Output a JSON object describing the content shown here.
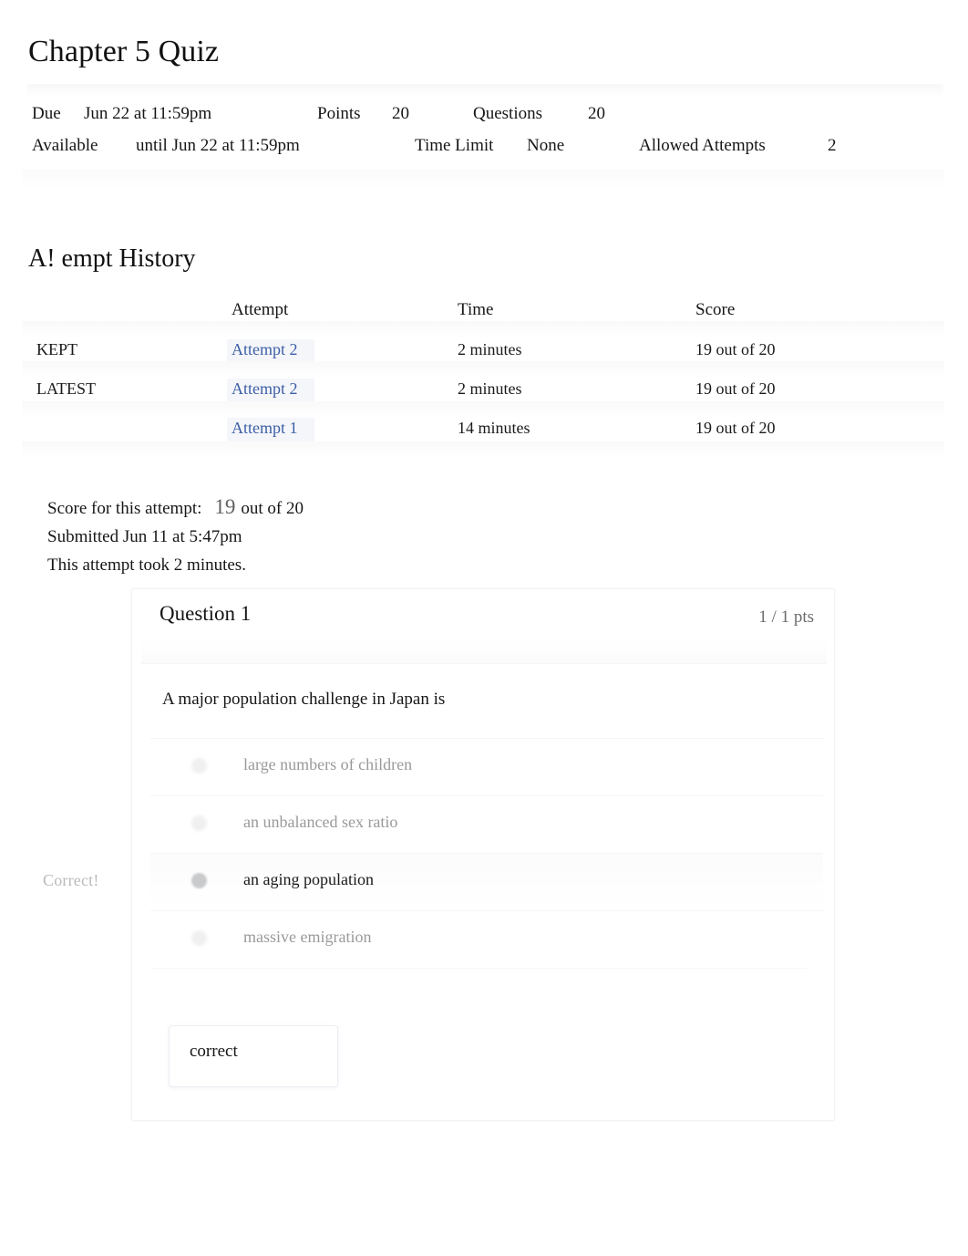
{
  "quiz": {
    "title": "Chapter 5 Quiz",
    "meta": {
      "due_label": "Due",
      "due_value": "Jun 22 at 11:59pm",
      "points_label": "Points",
      "points_value": "20",
      "questions_label": "Questions",
      "questions_value": "20",
      "available_label": "Available",
      "available_value": "until Jun 22 at 11:59pm",
      "time_limit_label": "Time Limit",
      "time_limit_value": "None",
      "allowed_attempts_label": "Allowed Attempts",
      "allowed_attempts_value": "2"
    }
  },
  "attempt_history": {
    "heading": "A! empt History",
    "columns": [
      "",
      "Attempt",
      "Time",
      "Score"
    ],
    "rows": [
      {
        "label": "KEPT",
        "attempt": "Attempt 2",
        "time": "2 minutes",
        "score": "19 out of 20"
      },
      {
        "label": "LATEST",
        "attempt": "Attempt 2",
        "time": "2 minutes",
        "score": "19 out of 20"
      },
      {
        "label": "",
        "attempt": "Attempt 1",
        "time": "14 minutes",
        "score": "19 out of 20"
      }
    ]
  },
  "score_summary": {
    "score_label": "Score for this attempt:",
    "score_value": "19",
    "score_suffix": "out of 20",
    "submitted": "Submitted Jun 11 at 5:47pm",
    "duration": "This attempt took 2 minutes."
  },
  "question": {
    "title": "Question 1",
    "points": "1 / 1 pts",
    "prompt": "A major population challenge in Japan is",
    "correct_flag": "Correct!",
    "answers": [
      {
        "text": "large numbers of children",
        "selected": false
      },
      {
        "text": "an unbalanced sex ratio",
        "selected": false
      },
      {
        "text": "an aging population",
        "selected": true
      },
      {
        "text": "massive emigration",
        "selected": false
      }
    ],
    "comment": "correct"
  },
  "colors": {
    "link": "#3c5fa5",
    "text": "#161616",
    "muted": "#9a9a9c",
    "flag": "#b9babb"
  }
}
